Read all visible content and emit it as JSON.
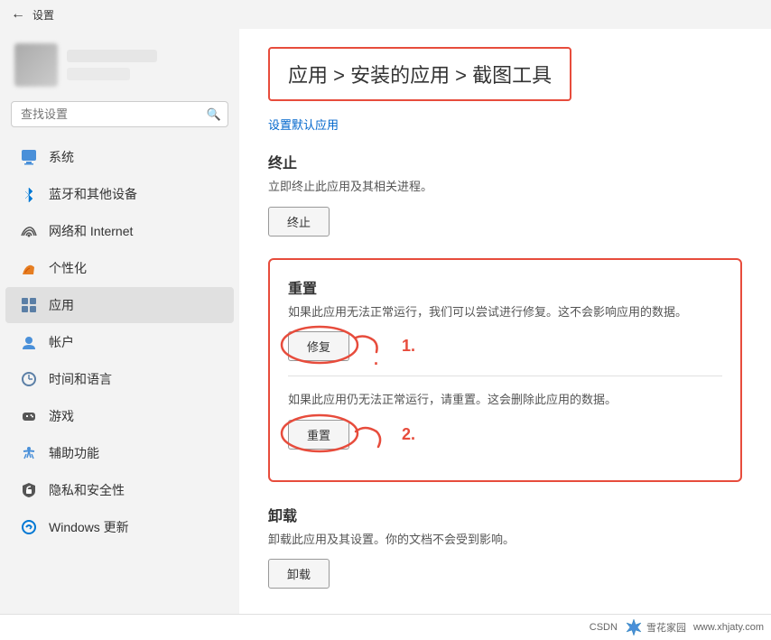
{
  "titleBar": {
    "backLabel": "←",
    "title": "设置"
  },
  "sidebar": {
    "searchPlaceholder": "查找设置",
    "navItems": [
      {
        "id": "system",
        "label": "系统",
        "iconType": "system"
      },
      {
        "id": "bluetooth",
        "label": "蓝牙和其他设备",
        "iconType": "bluetooth"
      },
      {
        "id": "network",
        "label": "网络和 Internet",
        "iconType": "network"
      },
      {
        "id": "personalization",
        "label": "个性化",
        "iconType": "personal"
      },
      {
        "id": "apps",
        "label": "应用",
        "iconType": "apps",
        "active": true
      },
      {
        "id": "accounts",
        "label": "帐户",
        "iconType": "account"
      },
      {
        "id": "time",
        "label": "时间和语言",
        "iconType": "time"
      },
      {
        "id": "gaming",
        "label": "游戏",
        "iconType": "game"
      },
      {
        "id": "accessibility",
        "label": "辅助功能",
        "iconType": "assist"
      },
      {
        "id": "privacy",
        "label": "隐私和安全性",
        "iconType": "privacy"
      },
      {
        "id": "windowsUpdate",
        "label": "Windows 更新",
        "iconType": "update"
      }
    ]
  },
  "content": {
    "breadcrumb": "应用 > 安装的应用 > 截图工具",
    "setDefaultLink": "设置默认应用",
    "terminateSection": {
      "title": "终止",
      "desc": "立即终止此应用及其相关进程。",
      "buttonLabel": "终止"
    },
    "resetSection": {
      "title": "重置",
      "repairSubTitle": "",
      "repairDesc": "如果此应用无法正常运行，我们可以尝试进行修复。这不会影响应用的数据。",
      "repairButtonLabel": "修复",
      "resetDesc": "如果此应用仍无法正常运行，请重置。这会删除此应用的数据。",
      "resetButtonLabel": "重置"
    },
    "uninstallSection": {
      "title": "卸载",
      "desc": "卸载此应用及其设置。你的文档不会受到影响。",
      "buttonLabel": "卸载"
    }
  },
  "bottomBar": {
    "csdnLabel": "CSDN",
    "watermarkLabel": "雪花家园",
    "watermarkUrl": "www.xhjaty.com"
  }
}
